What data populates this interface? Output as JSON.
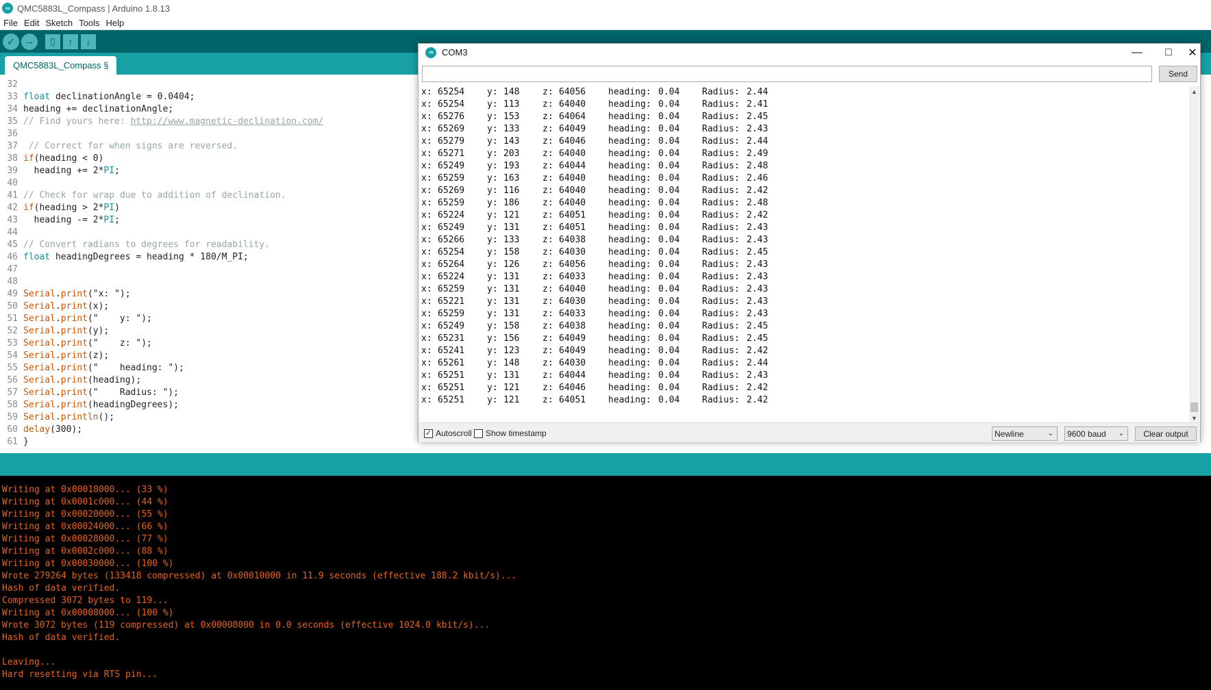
{
  "app_title": "QMC5883L_Compass | Arduino 1.8.13",
  "menu": [
    "File",
    "Edit",
    "Sketch",
    "Tools",
    "Help"
  ],
  "toolbar": {
    "verify": "✓",
    "upload": "→",
    "new": "▯",
    "open": "↑",
    "save": "↓"
  },
  "editor_tab": "QMC5883L_Compass §",
  "code_lines": [
    {
      "n": "32",
      "parts": [
        {
          "t": "",
          "c": ""
        }
      ]
    },
    {
      "n": "33",
      "parts": [
        {
          "t": "float",
          "c": "cn"
        },
        {
          "t": " declinationAngle = 0.0404;",
          "c": ""
        }
      ]
    },
    {
      "n": "34",
      "parts": [
        {
          "t": "heading += declinationAngle;",
          "c": ""
        }
      ]
    },
    {
      "n": "35",
      "parts": [
        {
          "t": "// Find yours here: ",
          "c": "cm"
        },
        {
          "t": "http://www.magnetic-declination.com/",
          "c": "cm ul"
        }
      ]
    },
    {
      "n": "36",
      "parts": [
        {
          "t": "",
          "c": ""
        }
      ]
    },
    {
      "n": "37",
      "parts": [
        {
          "t": " // Correct for when signs are reversed.",
          "c": "cm"
        }
      ]
    },
    {
      "n": "38",
      "parts": [
        {
          "t": "if",
          "c": "kw"
        },
        {
          "t": "(heading < 0)",
          "c": ""
        }
      ]
    },
    {
      "n": "39",
      "parts": [
        {
          "t": "  heading += 2*",
          "c": ""
        },
        {
          "t": "PI",
          "c": "cn"
        },
        {
          "t": ";",
          "c": ""
        }
      ]
    },
    {
      "n": "40",
      "parts": [
        {
          "t": "",
          "c": ""
        }
      ]
    },
    {
      "n": "41",
      "parts": [
        {
          "t": "// Check for wrap due to addition of declination.",
          "c": "cm"
        }
      ]
    },
    {
      "n": "42",
      "parts": [
        {
          "t": "if",
          "c": "kw"
        },
        {
          "t": "(heading > 2*",
          "c": ""
        },
        {
          "t": "PI",
          "c": "cn"
        },
        {
          "t": ")",
          "c": ""
        }
      ]
    },
    {
      "n": "43",
      "parts": [
        {
          "t": "  heading -= 2*",
          "c": ""
        },
        {
          "t": "PI",
          "c": "cn"
        },
        {
          "t": ";",
          "c": ""
        }
      ]
    },
    {
      "n": "44",
      "parts": [
        {
          "t": "",
          "c": ""
        }
      ]
    },
    {
      "n": "45",
      "parts": [
        {
          "t": "// Convert radians to degrees for readability.",
          "c": "cm"
        }
      ]
    },
    {
      "n": "46",
      "parts": [
        {
          "t": "float",
          "c": "cn"
        },
        {
          "t": " headingDegrees = heading * 180/M_PI;",
          "c": ""
        }
      ]
    },
    {
      "n": "47",
      "parts": [
        {
          "t": "",
          "c": ""
        }
      ]
    },
    {
      "n": "48",
      "parts": [
        {
          "t": "",
          "c": ""
        }
      ]
    },
    {
      "n": "49",
      "parts": [
        {
          "t": "Serial",
          "c": "kw"
        },
        {
          "t": ".",
          "c": ""
        },
        {
          "t": "print",
          "c": "kw"
        },
        {
          "t": "(\"x: \");",
          "c": ""
        }
      ]
    },
    {
      "n": "50",
      "parts": [
        {
          "t": "Serial",
          "c": "kw"
        },
        {
          "t": ".",
          "c": ""
        },
        {
          "t": "print",
          "c": "kw"
        },
        {
          "t": "(x);",
          "c": ""
        }
      ]
    },
    {
      "n": "51",
      "parts": [
        {
          "t": "Serial",
          "c": "kw"
        },
        {
          "t": ".",
          "c": ""
        },
        {
          "t": "print",
          "c": "kw"
        },
        {
          "t": "(\"    y: \");",
          "c": ""
        }
      ]
    },
    {
      "n": "52",
      "parts": [
        {
          "t": "Serial",
          "c": "kw"
        },
        {
          "t": ".",
          "c": ""
        },
        {
          "t": "print",
          "c": "kw"
        },
        {
          "t": "(y);",
          "c": ""
        }
      ]
    },
    {
      "n": "53",
      "parts": [
        {
          "t": "Serial",
          "c": "kw"
        },
        {
          "t": ".",
          "c": ""
        },
        {
          "t": "print",
          "c": "kw"
        },
        {
          "t": "(\"    z: \");",
          "c": ""
        }
      ]
    },
    {
      "n": "54",
      "parts": [
        {
          "t": "Serial",
          "c": "kw"
        },
        {
          "t": ".",
          "c": ""
        },
        {
          "t": "print",
          "c": "kw"
        },
        {
          "t": "(z);",
          "c": ""
        }
      ]
    },
    {
      "n": "55",
      "parts": [
        {
          "t": "Serial",
          "c": "kw"
        },
        {
          "t": ".",
          "c": ""
        },
        {
          "t": "print",
          "c": "kw"
        },
        {
          "t": "(\"    heading: \");",
          "c": ""
        }
      ]
    },
    {
      "n": "56",
      "parts": [
        {
          "t": "Serial",
          "c": "kw"
        },
        {
          "t": ".",
          "c": ""
        },
        {
          "t": "print",
          "c": "kw"
        },
        {
          "t": "(heading);",
          "c": ""
        }
      ]
    },
    {
      "n": "57",
      "parts": [
        {
          "t": "Serial",
          "c": "kw"
        },
        {
          "t": ".",
          "c": ""
        },
        {
          "t": "print",
          "c": "kw"
        },
        {
          "t": "(\"    Radius: \");",
          "c": ""
        }
      ]
    },
    {
      "n": "58",
      "parts": [
        {
          "t": "Serial",
          "c": "kw"
        },
        {
          "t": ".",
          "c": ""
        },
        {
          "t": "print",
          "c": "kw"
        },
        {
          "t": "(headingDegrees);",
          "c": ""
        }
      ]
    },
    {
      "n": "59",
      "parts": [
        {
          "t": "Serial",
          "c": "kw"
        },
        {
          "t": ".",
          "c": ""
        },
        {
          "t": "println",
          "c": "kw"
        },
        {
          "t": "();",
          "c": ""
        }
      ]
    },
    {
      "n": "60",
      "parts": [
        {
          "t": "delay",
          "c": "kw"
        },
        {
          "t": "(300);",
          "c": ""
        }
      ]
    },
    {
      "n": "61",
      "parts": [
        {
          "t": "}",
          "c": ""
        }
      ]
    }
  ],
  "console_lines": [
    "Writing at 0x00018000... (33 %)",
    "Writing at 0x0001c000... (44 %)",
    "Writing at 0x00020000... (55 %)",
    "Writing at 0x00024000... (66 %)",
    "Writing at 0x00028000... (77 %)",
    "Writing at 0x0002c000... (88 %)",
    "Writing at 0x00030000... (100 %)",
    "Wrote 279264 bytes (133418 compressed) at 0x00010000 in 11.9 seconds (effective 188.2 kbit/s)...",
    "Hash of data verified.",
    "Compressed 3072 bytes to 119...",
    "Writing at 0x00008000... (100 %)",
    "Wrote 3072 bytes (119 compressed) at 0x00008000 in 0.0 seconds (effective 1024.0 kbit/s)...",
    "Hash of data verified.",
    "",
    "Leaving...",
    "Hard resetting via RTS pin..."
  ],
  "serial_monitor": {
    "title": "COM3",
    "input_value": "",
    "send_label": "Send",
    "autoscroll_label": "Autoscroll",
    "autoscroll_checked": true,
    "timestamp_label": "Show timestamp",
    "timestamp_checked": false,
    "line_ending": "Newline",
    "baud": "9600 baud",
    "clear_label": "Clear output",
    "rows": [
      {
        "x": "65254",
        "y": "148",
        "z": "64056",
        "heading": "0.04",
        "radius": "2.44"
      },
      {
        "x": "65254",
        "y": "113",
        "z": "64040",
        "heading": "0.04",
        "radius": "2.41"
      },
      {
        "x": "65276",
        "y": "153",
        "z": "64064",
        "heading": "0.04",
        "radius": "2.45"
      },
      {
        "x": "65269",
        "y": "133",
        "z": "64049",
        "heading": "0.04",
        "radius": "2.43"
      },
      {
        "x": "65279",
        "y": "143",
        "z": "64046",
        "heading": "0.04",
        "radius": "2.44"
      },
      {
        "x": "65271",
        "y": "203",
        "z": "64040",
        "heading": "0.04",
        "radius": "2.49"
      },
      {
        "x": "65249",
        "y": "193",
        "z": "64044",
        "heading": "0.04",
        "radius": "2.48"
      },
      {
        "x": "65259",
        "y": "163",
        "z": "64040",
        "heading": "0.04",
        "radius": "2.46"
      },
      {
        "x": "65269",
        "y": "116",
        "z": "64040",
        "heading": "0.04",
        "radius": "2.42"
      },
      {
        "x": "65259",
        "y": "186",
        "z": "64040",
        "heading": "0.04",
        "radius": "2.48"
      },
      {
        "x": "65224",
        "y": "121",
        "z": "64051",
        "heading": "0.04",
        "radius": "2.42"
      },
      {
        "x": "65249",
        "y": "131",
        "z": "64051",
        "heading": "0.04",
        "radius": "2.43"
      },
      {
        "x": "65266",
        "y": "133",
        "z": "64038",
        "heading": "0.04",
        "radius": "2.43"
      },
      {
        "x": "65254",
        "y": "158",
        "z": "64030",
        "heading": "0.04",
        "radius": "2.45"
      },
      {
        "x": "65264",
        "y": "126",
        "z": "64056",
        "heading": "0.04",
        "radius": "2.43"
      },
      {
        "x": "65224",
        "y": "131",
        "z": "64033",
        "heading": "0.04",
        "radius": "2.43"
      },
      {
        "x": "65259",
        "y": "131",
        "z": "64040",
        "heading": "0.04",
        "radius": "2.43"
      },
      {
        "x": "65221",
        "y": "131",
        "z": "64030",
        "heading": "0.04",
        "radius": "2.43"
      },
      {
        "x": "65259",
        "y": "131",
        "z": "64033",
        "heading": "0.04",
        "radius": "2.43"
      },
      {
        "x": "65249",
        "y": "158",
        "z": "64038",
        "heading": "0.04",
        "radius": "2.45"
      },
      {
        "x": "65231",
        "y": "156",
        "z": "64049",
        "heading": "0.04",
        "radius": "2.45"
      },
      {
        "x": "65241",
        "y": "123",
        "z": "64049",
        "heading": "0.04",
        "radius": "2.42"
      },
      {
        "x": "65261",
        "y": "148",
        "z": "64030",
        "heading": "0.04",
        "radius": "2.44"
      },
      {
        "x": "65251",
        "y": "131",
        "z": "64044",
        "heading": "0.04",
        "radius": "2.43"
      },
      {
        "x": "65251",
        "y": "121",
        "z": "64046",
        "heading": "0.04",
        "radius": "2.42"
      },
      {
        "x": "65251",
        "y": "121",
        "z": "64051",
        "heading": "0.04",
        "radius": "2.42"
      }
    ]
  },
  "colors": {
    "teal_dark": "#006468",
    "teal": "#17a1a5",
    "console_text": "#e8621c"
  }
}
